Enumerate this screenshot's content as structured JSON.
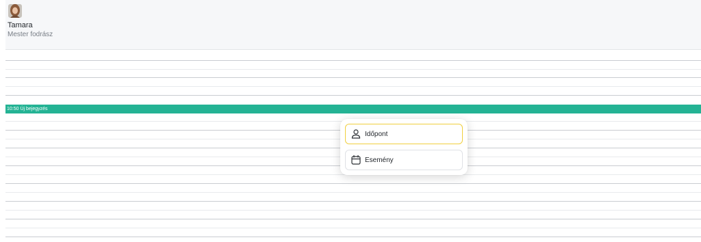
{
  "resource": {
    "name": "Tamara",
    "role": "Mester fodrász"
  },
  "calendar": {
    "new_entry": {
      "time": "10:50",
      "label": "10:50 Új bejegyzés",
      "color": "#24b394"
    }
  },
  "popup_menu": {
    "items": [
      {
        "label": "Időpont",
        "icon": "person-icon"
      },
      {
        "label": "Esemény",
        "icon": "calendar-icon"
      }
    ],
    "highlight_color": "#f0cf3d"
  }
}
